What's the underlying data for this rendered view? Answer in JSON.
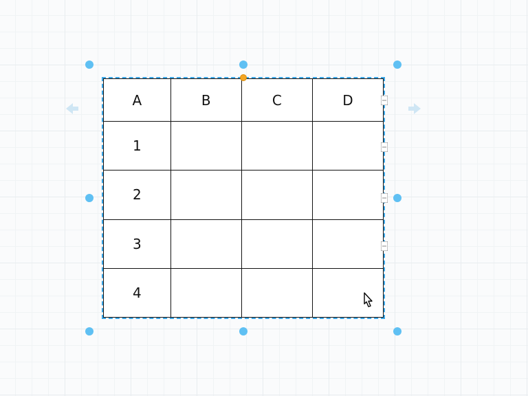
{
  "canvas": {
    "accent_color": "#5fc0f3",
    "rotation_handle_color": "#f5a623"
  },
  "table": {
    "headers": [
      "A",
      "B",
      "C",
      "D"
    ],
    "rows": [
      {
        "label": "1",
        "cells": [
          "",
          "",
          ""
        ]
      },
      {
        "label": "2",
        "cells": [
          "",
          "",
          ""
        ]
      },
      {
        "label": "3",
        "cells": [
          "",
          "",
          ""
        ]
      },
      {
        "label": "4",
        "cells": [
          "",
          "",
          ""
        ]
      }
    ]
  },
  "chart_data": {
    "type": "table",
    "title": "",
    "columns": [
      "A",
      "B",
      "C",
      "D"
    ],
    "rows": [
      [
        "1",
        "",
        "",
        ""
      ],
      [
        "2",
        "",
        "",
        ""
      ],
      [
        "3",
        "",
        "",
        ""
      ],
      [
        "4",
        "",
        "",
        ""
      ]
    ]
  }
}
